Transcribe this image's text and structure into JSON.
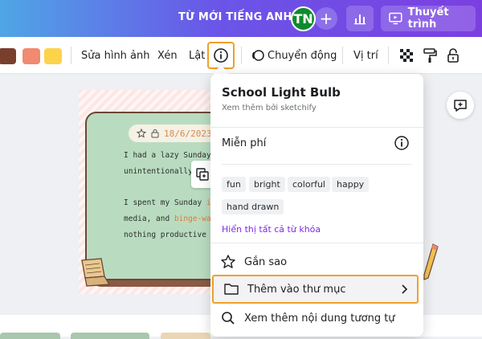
{
  "topbar": {
    "doc_title": "TỪ MỚI TIẾNG ANH",
    "avatar_initials": "TN",
    "add_label": "+",
    "present_label": "Thuyết trình"
  },
  "toolbar": {
    "swatches": [
      "#7a3f2c",
      "#f08a70",
      "#fdd34a"
    ],
    "edit_image": "Sửa hình ảnh",
    "crop": "Xén",
    "flip": "Lật",
    "animate": "Chuyển động",
    "position": "Vị trí"
  },
  "canvas": {
    "date": "18/6/2023",
    "lines": [
      "I had a lazy Sunday. I",
      "unintentionally fell",
      "",
      "I spent my Sunday",
      "media, and",
      "nothing productive and we"
    ],
    "highlight_1": "indulg",
    "highlight_2": "binge-watchin"
  },
  "popup": {
    "title": "School Light Bulb",
    "subtitle": "Xem thêm bởi sketchify",
    "price": "Miễn phí",
    "tags": [
      "fun",
      "bright",
      "colorful",
      "happy",
      "hand drawn"
    ],
    "show_keywords": "Hiển thị tất cả từ khóa",
    "star_label": "Gắn sao",
    "add_folder_label": "Thêm vào thư mục",
    "similar_label": "Xem thêm nội dung tương tự"
  },
  "colors": {
    "accent": "#7d2ae8",
    "highlight_border": "#f0a02a"
  }
}
